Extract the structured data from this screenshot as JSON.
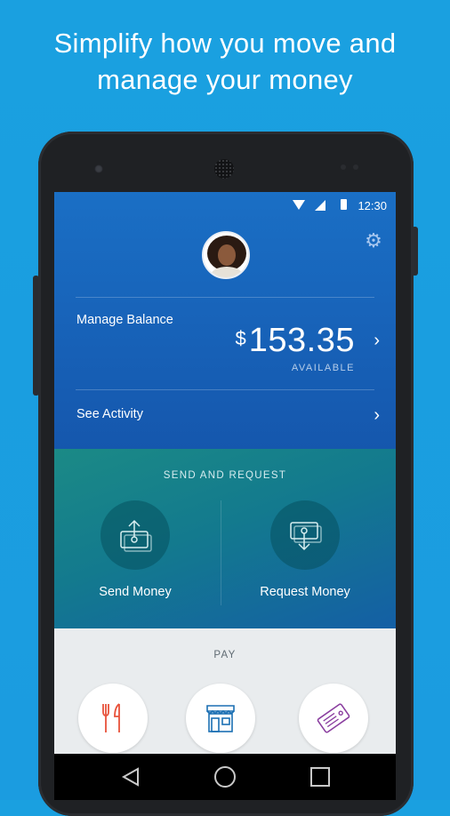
{
  "headline": {
    "line1": "Simplify how you move and",
    "line2": "manage your money"
  },
  "status_bar": {
    "time": "12:30",
    "icons": [
      "wifi-icon",
      "signal-icon",
      "battery-icon"
    ]
  },
  "header": {
    "settings_icon": "gear-icon",
    "avatar": "user-avatar"
  },
  "balance": {
    "label": "Manage Balance",
    "currency_symbol": "$",
    "amount": "153.35",
    "status": "AVAILABLE"
  },
  "activity": {
    "label": "See Activity"
  },
  "send_request": {
    "title": "SEND AND REQUEST",
    "send_label": "Send Money",
    "request_label": "Request Money"
  },
  "pay": {
    "title": "PAY",
    "items": [
      "restaurant-icon",
      "store-icon",
      "ticket-icon"
    ]
  },
  "colors": {
    "background": "#1b9ce0",
    "header_blue": "#1a6fc5",
    "teal": "#1b8a86",
    "pay_bg": "#e9ecee",
    "restaurant": "#e8523a",
    "store": "#1b6fb3",
    "ticket": "#8b3fa0"
  }
}
